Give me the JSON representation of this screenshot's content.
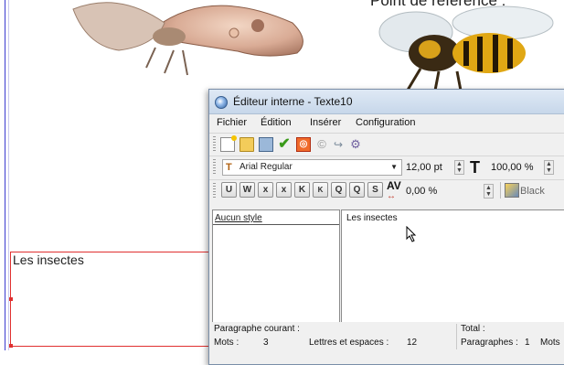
{
  "document": {
    "caption_text": "Point de référence :",
    "frame_text": "Les insectes"
  },
  "editor": {
    "title": "Éditeur interne - Texte10",
    "menu": [
      "Fichier",
      "Édition",
      "Insérer",
      "Configuration"
    ],
    "toolbar_icons": [
      "new-document-icon",
      "open-folder-icon",
      "save-icon",
      "check-icon",
      "stop-icon",
      "copyright-icon",
      "arrow-icon",
      "tools-icon"
    ],
    "font": {
      "family": "Arial Regular",
      "size": "12,00 pt",
      "scale": "100,00 %"
    },
    "format_buttons": [
      "U",
      "W",
      "x",
      "x",
      "K",
      "K",
      "Q",
      "Q",
      "S"
    ],
    "tracking": "0,00 %",
    "color": "Black",
    "style_panel_header": "Aucun style",
    "text_content": "Les insectes",
    "status": {
      "current_paragraph_label": "Paragraphe courant :",
      "words_label": "Mots :",
      "words_value": "3",
      "letters_label": "Lettres et espaces :",
      "letters_value": "12",
      "total_label": "Total :",
      "paragraphs_label": "Paragraphes :",
      "paragraphs_value": "1",
      "total_words_label": "Mots"
    }
  }
}
